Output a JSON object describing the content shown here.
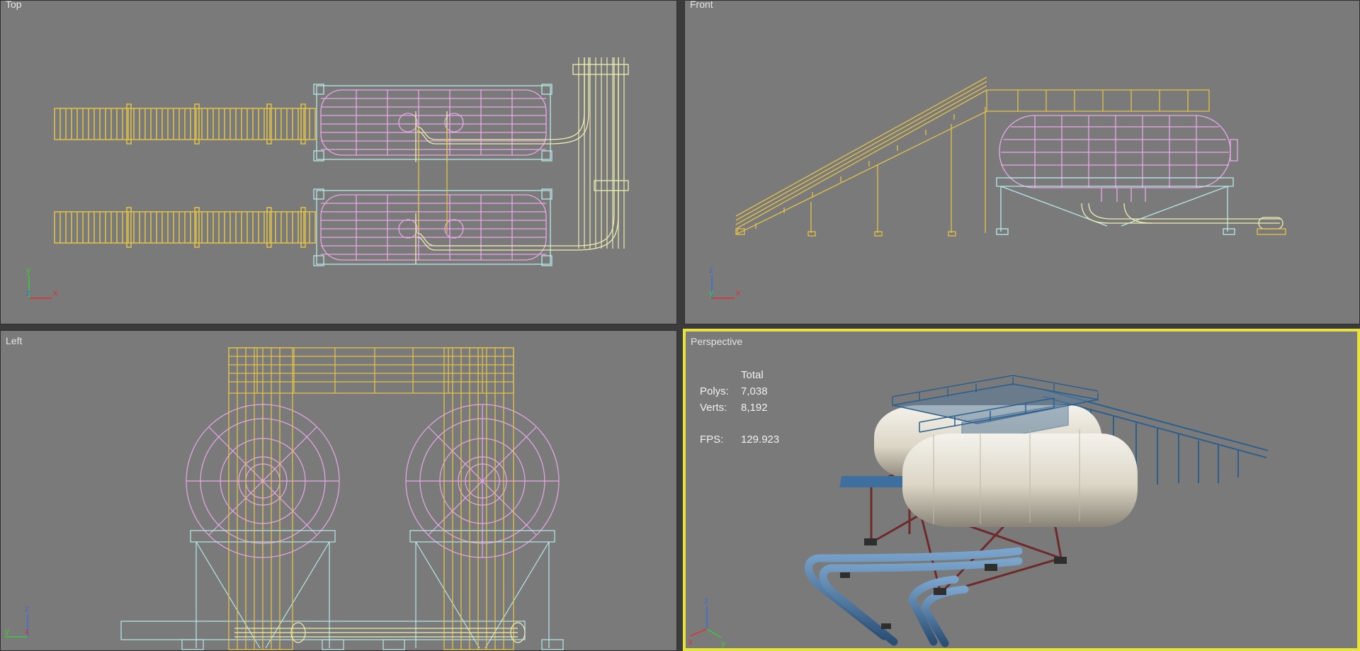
{
  "viewports": {
    "top": {
      "label": "Top"
    },
    "front": {
      "label": "Front"
    },
    "left": {
      "label": "Left"
    },
    "perspective": {
      "label": "Perspective"
    }
  },
  "stats": {
    "header": "Total",
    "polys_label": "Polys:",
    "polys_value": "7,038",
    "verts_label": "Verts:",
    "verts_value": "8,192",
    "fps_label": "FPS:",
    "fps_value": "129.923"
  },
  "axes": {
    "x": "x",
    "y": "y",
    "z": "z"
  },
  "colors": {
    "viewport_bg": "#7a7a7a",
    "active_border": "#e8e23c",
    "walkway": "#e2c24a",
    "tank_wire": "#e8a8e8",
    "frame_wire": "#b8e8e8",
    "pipe_wire": "#eeeeb0",
    "pipe_solid": "#3f6f9f",
    "tank_solid": "#e8e4da",
    "frame_solid": "#7a2e2e"
  }
}
